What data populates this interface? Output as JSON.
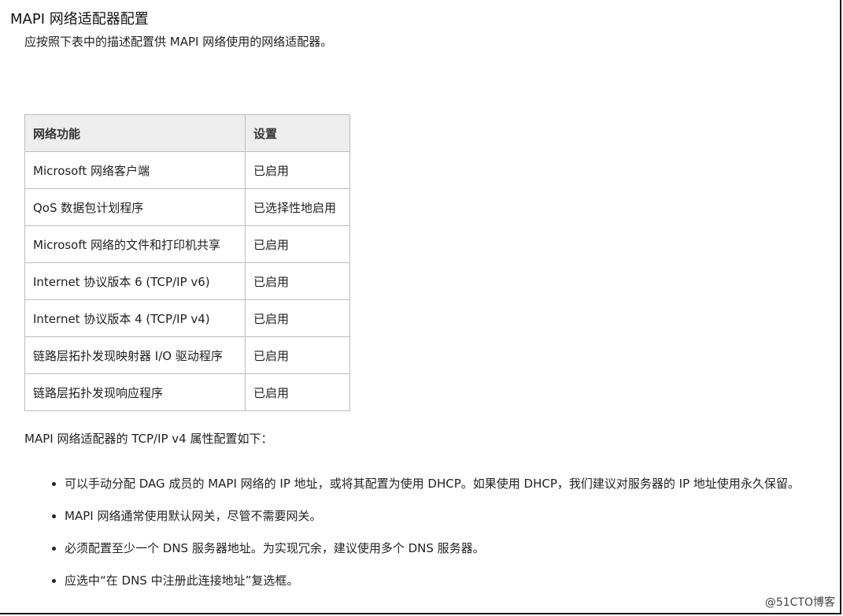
{
  "title": "MAPI 网络适配器配置",
  "intro": "应按照下表中的描述配置供 MAPI 网络使用的网络适配器。",
  "table": {
    "headers": [
      "网络功能",
      "设置"
    ],
    "rows": [
      [
        "Microsoft 网络客户端",
        "已启用"
      ],
      [
        "QoS 数据包计划程序",
        "已选择性地启用"
      ],
      [
        "Microsoft 网络的文件和打印机共享",
        "已启用"
      ],
      [
        "Internet 协议版本 6 (TCP/IP v6)",
        "已启用"
      ],
      [
        "Internet 协议版本 4 (TCP/IP v4)",
        "已启用"
      ],
      [
        "链路层拓扑发现映射器 I/O 驱动程序",
        "已启用"
      ],
      [
        "链路层拓扑发现响应程序",
        "已启用"
      ]
    ]
  },
  "paragraph": "MAPI 网络适配器的 TCP/IP v4 属性配置如下：",
  "bullets": [
    "可以手动分配 DAG 成员的 MAPI 网络的 IP 地址，或将其配置为使用 DHCP。如果使用 DHCP，我们建议对服务器的 IP 地址使用永久保留。",
    "MAPI 网络通常使用默认网关，尽管不需要网关。",
    "必须配置至少一个 DNS 服务器地址。为实现冗余，建议使用多个 DNS 服务器。",
    "应选中“在 DNS 中注册此连接地址”复选框。"
  ],
  "watermark": "@51CTO博客"
}
